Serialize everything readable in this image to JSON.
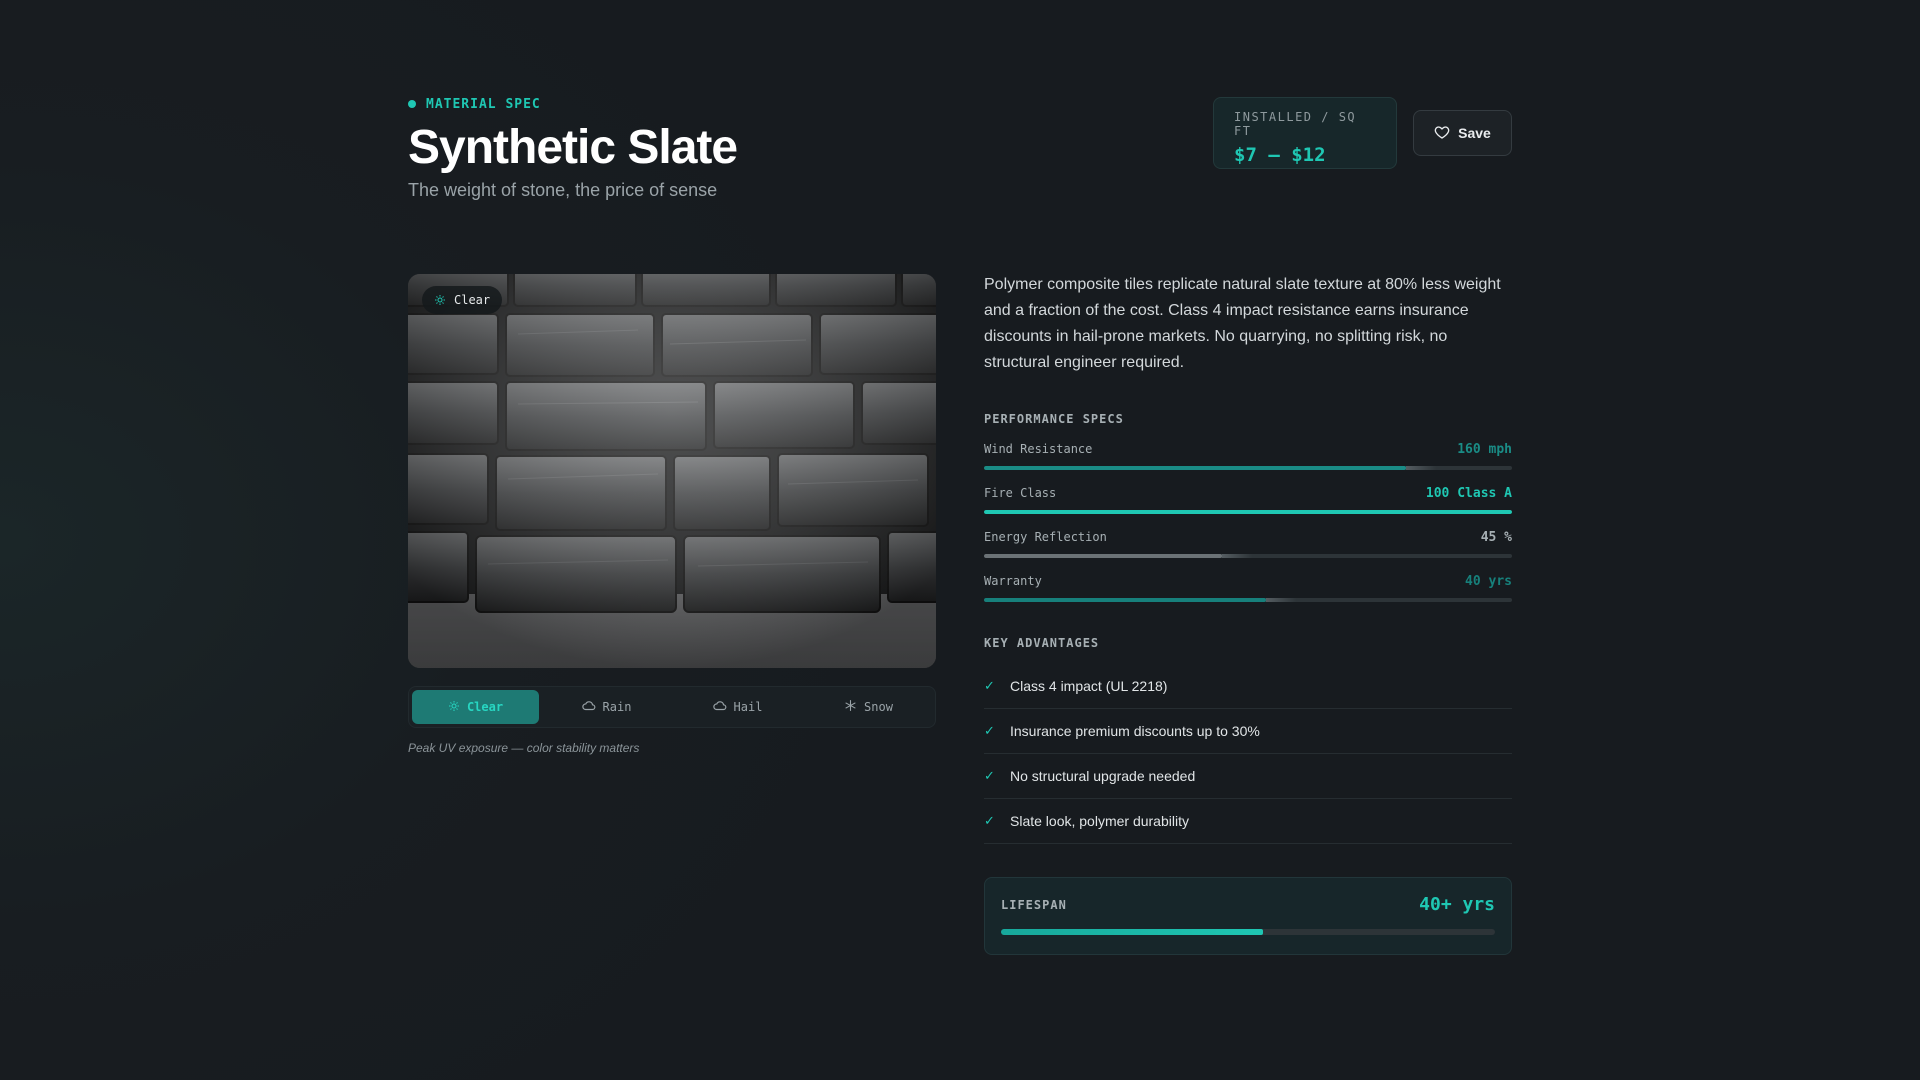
{
  "header": {
    "eyebrow": "MATERIAL SPEC",
    "title": "Synthetic Slate",
    "subtitle": "The weight of stone, the price of sense",
    "price_label": "INSTALLED / SQ FT",
    "price_value": "$7 – $12",
    "save_label": "Save"
  },
  "image": {
    "badge_label": "Clear",
    "badge_icon": "sun-icon"
  },
  "weather_tabs": [
    {
      "label": "Clear",
      "icon": "sun-icon",
      "active": true
    },
    {
      "label": "Rain",
      "icon": "cloud-icon",
      "active": false
    },
    {
      "label": "Hail",
      "icon": "cloud-icon",
      "active": false
    },
    {
      "label": "Snow",
      "icon": "snowflake-icon",
      "active": false
    }
  ],
  "caption": "Peak UV exposure — color stability matters",
  "description": "Polymer composite tiles replicate natural slate texture at 80% less weight and a fraction of the cost. Class 4 impact resistance earns insurance discounts in hail-prone markets. No quarrying, no splitting risk, no structural engineer required.",
  "specs": {
    "heading": "PERFORMANCE SPECS",
    "items": [
      {
        "name": "Wind Resistance",
        "value": "160 mph",
        "fraction": 0.8,
        "color": "#1a8c86",
        "value_color": "#1a8c86"
      },
      {
        "name": "Fire Class",
        "value": "100 Class A",
        "fraction": 1.0,
        "color": "#1fc7b3",
        "value_color": "#1fc7b3"
      },
      {
        "name": "Energy Reflection",
        "value": "45 %",
        "fraction": 0.45,
        "color": "#6b7276",
        "value_color": "#a7b0b4"
      },
      {
        "name": "Warranty",
        "value": "40 yrs",
        "fraction": 0.535,
        "color": "#17807b",
        "value_color": "#17807b"
      }
    ]
  },
  "advantages": {
    "heading": "KEY ADVANTAGES",
    "items": [
      "Class 4 impact (UL 2218)",
      "Insurance premium discounts up to 30%",
      "No structural upgrade needed",
      "Slate look, polymer durability"
    ]
  },
  "lifespan": {
    "label": "LIFESPAN",
    "value": "40+ yrs",
    "fraction": 0.53
  },
  "colors": {
    "accent": "#1fc7b3",
    "background": "#181d21"
  }
}
